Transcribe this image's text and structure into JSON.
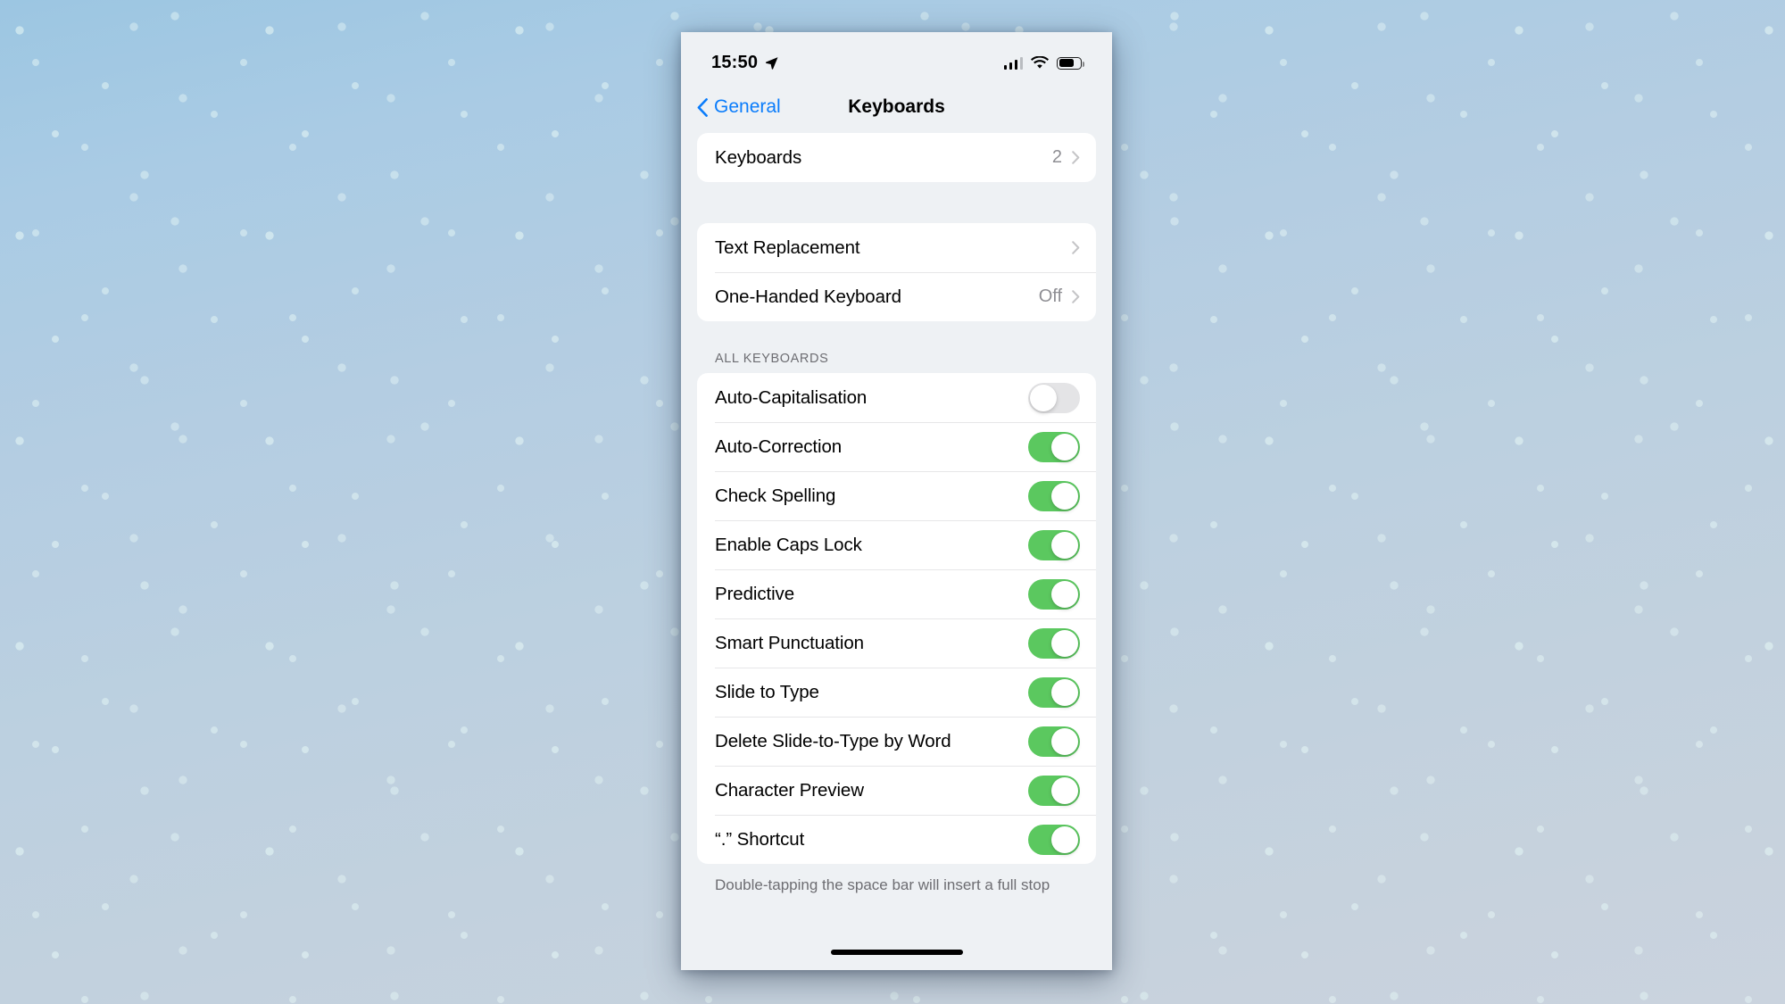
{
  "status_bar": {
    "time": "15:50",
    "location_icon": "location-arrow-icon",
    "signal_icon": "cellular-signal-icon",
    "signal_bars_filled": 3,
    "signal_bars_total": 4,
    "wifi_icon": "wifi-icon",
    "battery_icon": "battery-icon",
    "battery_level_percent": 70
  },
  "nav": {
    "back_label": "General",
    "back_icon": "chevron-left-icon",
    "title": "Keyboards"
  },
  "groups": [
    {
      "id": "keyboards-group",
      "rows": [
        {
          "name": "keyboards",
          "label": "Keyboards",
          "value": "2",
          "type": "disclosure"
        }
      ]
    },
    {
      "id": "text-options-group",
      "rows": [
        {
          "name": "text-replacement",
          "label": "Text Replacement",
          "value": "",
          "type": "disclosure"
        },
        {
          "name": "one-handed-keyboard",
          "label": "One-Handed Keyboard",
          "value": "Off",
          "type": "disclosure"
        }
      ]
    }
  ],
  "all_keyboards": {
    "header": "ALL KEYBOARDS",
    "rows": [
      {
        "name": "auto-capitalisation",
        "label": "Auto-Capitalisation",
        "on": false
      },
      {
        "name": "auto-correction",
        "label": "Auto-Correction",
        "on": true
      },
      {
        "name": "check-spelling",
        "label": "Check Spelling",
        "on": true
      },
      {
        "name": "enable-caps-lock",
        "label": "Enable Caps Lock",
        "on": true
      },
      {
        "name": "predictive",
        "label": "Predictive",
        "on": true
      },
      {
        "name": "smart-punctuation",
        "label": "Smart Punctuation",
        "on": true
      },
      {
        "name": "slide-to-type",
        "label": "Slide to Type",
        "on": true
      },
      {
        "name": "delete-slide-to-type-by-word",
        "label": "Delete Slide-to-Type by Word",
        "on": true
      },
      {
        "name": "character-preview",
        "label": "Character Preview",
        "on": true
      },
      {
        "name": "full-stop-shortcut",
        "label": "“.” Shortcut",
        "on": true
      }
    ],
    "footer": "Double-tapping the space bar will insert a full stop"
  },
  "colors": {
    "accent_blue": "#0a7cfb",
    "toggle_on_green": "#5bc85f",
    "toggle_off_grey": "#e4e4e6",
    "secondary_text": "#8e8e93",
    "group_background": "#eef1f4"
  }
}
